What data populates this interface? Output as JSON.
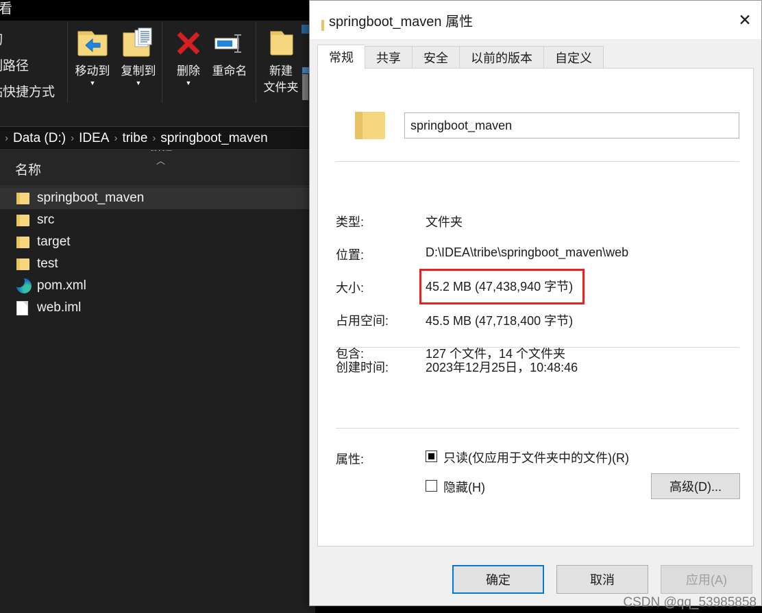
{
  "explorer": {
    "tab_view_label": "查看",
    "clipboard_labels": [
      "剪切",
      "复制路径",
      "粘贴快捷方式"
    ],
    "ribbon_group_label": "组织",
    "ribbon_buttons": [
      {
        "label": "移动到",
        "icon": "move-to-icon",
        "has_caret": true
      },
      {
        "label": "复制到",
        "icon": "copy-to-icon",
        "has_caret": true
      },
      {
        "label": "删除",
        "icon": "delete-icon",
        "has_caret": true
      },
      {
        "label": "重命名",
        "icon": "rename-icon",
        "has_caret": false
      },
      {
        "label": "新建\n文件夹",
        "label_line1": "新建",
        "label_line2": "文件夹",
        "icon": "new-folder-icon",
        "has_caret": false
      }
    ],
    "breadcrumb": [
      "Data (D:)",
      "IDEA",
      "tribe",
      "springboot_maven"
    ],
    "breadcrumb_separator": "›",
    "column_header_name": "名称",
    "files": [
      {
        "name": "springboot_maven",
        "icon": "folder-icon",
        "selected": true
      },
      {
        "name": "src",
        "icon": "folder-icon",
        "selected": false
      },
      {
        "name": "target",
        "icon": "folder-icon",
        "selected": false
      },
      {
        "name": "test",
        "icon": "folder-icon",
        "selected": false
      },
      {
        "name": "pom.xml",
        "icon": "edge-browser-icon",
        "selected": false
      },
      {
        "name": "web.iml",
        "icon": "document-icon",
        "selected": false
      }
    ]
  },
  "dialog": {
    "title": "springboot_maven 属性",
    "title_icon": "folder-icon",
    "close_label": "✕",
    "tabs": [
      {
        "label": "常规",
        "active": true
      },
      {
        "label": "共享",
        "active": false
      },
      {
        "label": "安全",
        "active": false
      },
      {
        "label": "以前的版本",
        "active": false
      },
      {
        "label": "自定义",
        "active": false
      }
    ],
    "name_field": {
      "value": "springboot_maven",
      "icon": "folder-icon"
    },
    "properties": [
      {
        "label": "类型:",
        "value": "文件夹",
        "highlighted": false
      },
      {
        "label": "位置:",
        "value": "D:\\IDEA\\tribe\\springboot_maven\\web",
        "highlighted": false
      },
      {
        "label": "大小:",
        "value": "45.2 MB (47,438,940 字节)",
        "highlighted": true
      },
      {
        "label": "占用空间:",
        "value": "45.5 MB (47,718,400 字节)",
        "highlighted": false
      },
      {
        "label": "包含:",
        "value": "127 个文件，14 个文件夹",
        "highlighted": false
      }
    ],
    "created": {
      "label": "创建时间:",
      "value": "2023年12月25日，10:48:46"
    },
    "attributes": {
      "label": "属性:",
      "readonly": {
        "text": "只读(仅应用于文件夹中的文件)(R)",
        "state": "indeterminate"
      },
      "hidden": {
        "text": "隐藏(H)",
        "state": "unchecked"
      },
      "advanced_button": "高级(D)..."
    },
    "footer_buttons": [
      {
        "label": "确定",
        "style": "default"
      },
      {
        "label": "取消",
        "style": "normal"
      },
      {
        "label": "应用(A)",
        "style": "disabled"
      }
    ],
    "highlight_color": "#e8231f",
    "accent_color": "#0078d7"
  },
  "watermark": "CSDN @qq_53985858"
}
